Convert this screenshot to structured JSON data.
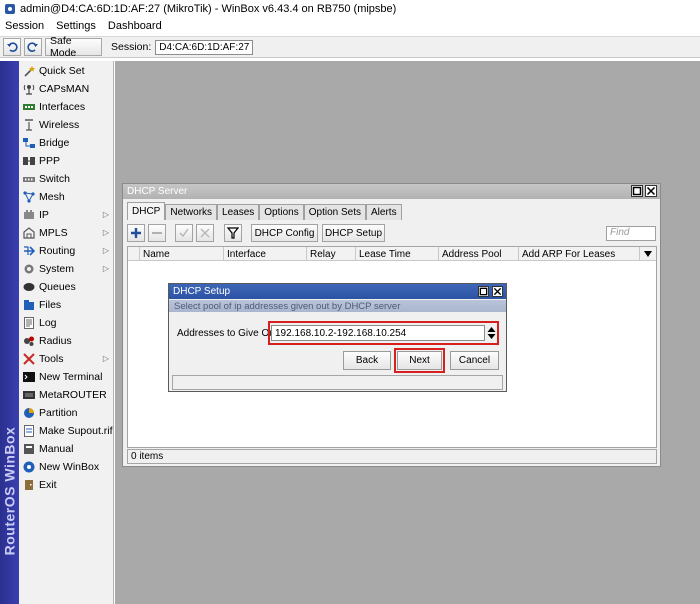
{
  "window": {
    "title": "admin@D4:CA:6D:1D:AF:27 (MikroTik) - WinBox v6.43.4 on RB750 (mipsbe)"
  },
  "menu": [
    "Session",
    "Settings",
    "Dashboard"
  ],
  "toolbar": {
    "safe_mode_label": "Safe Mode",
    "session_label": "Session:",
    "session_value": "D4:CA:6D:1D:AF:27"
  },
  "brand_label": "RouterOS WinBox",
  "sidebar": {
    "items": [
      {
        "label": "Quick Set",
        "icon": "wand-icon",
        "submenu": false
      },
      {
        "label": "CAPsMAN",
        "icon": "antenna-icon",
        "submenu": false
      },
      {
        "label": "Interfaces",
        "icon": "interfaces-icon",
        "submenu": false
      },
      {
        "label": "Wireless",
        "icon": "wireless-icon",
        "submenu": false
      },
      {
        "label": "Bridge",
        "icon": "bridge-icon",
        "submenu": false
      },
      {
        "label": "PPP",
        "icon": "ppp-icon",
        "submenu": false
      },
      {
        "label": "Switch",
        "icon": "switch-icon",
        "submenu": false
      },
      {
        "label": "Mesh",
        "icon": "mesh-icon",
        "submenu": false
      },
      {
        "label": "IP",
        "icon": "ip-icon",
        "submenu": true
      },
      {
        "label": "MPLS",
        "icon": "mpls-icon",
        "submenu": true
      },
      {
        "label": "Routing",
        "icon": "routing-icon",
        "submenu": true
      },
      {
        "label": "System",
        "icon": "system-gear-icon",
        "submenu": true
      },
      {
        "label": "Queues",
        "icon": "queues-icon",
        "submenu": false
      },
      {
        "label": "Files",
        "icon": "files-icon",
        "submenu": false
      },
      {
        "label": "Log",
        "icon": "log-icon",
        "submenu": false
      },
      {
        "label": "Radius",
        "icon": "radius-icon",
        "submenu": false
      },
      {
        "label": "Tools",
        "icon": "tools-icon",
        "submenu": true
      },
      {
        "label": "New Terminal",
        "icon": "terminal-icon",
        "submenu": false
      },
      {
        "label": "MetaROUTER",
        "icon": "metarouter-icon",
        "submenu": false
      },
      {
        "label": "Partition",
        "icon": "partition-icon",
        "submenu": false
      },
      {
        "label": "Make Supout.rif",
        "icon": "supout-icon",
        "submenu": false
      },
      {
        "label": "Manual",
        "icon": "manual-icon",
        "submenu": false
      },
      {
        "label": "New WinBox",
        "icon": "winbox-icon",
        "submenu": false
      },
      {
        "label": "Exit",
        "icon": "exit-icon",
        "submenu": false
      }
    ]
  },
  "dhcp_server": {
    "title": "DHCP Server",
    "tabs": [
      "DHCP",
      "Networks",
      "Leases",
      "Options",
      "Option Sets",
      "Alerts"
    ],
    "dhcp_config_label": "DHCP Config",
    "dhcp_setup_label": "DHCP Setup",
    "find_placeholder": "Find",
    "columns": [
      "Name",
      "Interface",
      "Relay",
      "Lease Time",
      "Address Pool",
      "Add ARP For Leases"
    ],
    "status": "0 items"
  },
  "dhcp_setup": {
    "title": "DHCP Setup",
    "subtitle": "Select pool of ip addresses given out by DHCP server",
    "field_label": "Addresses to Give Out:",
    "field_value": "192.168.10.2-192.168.10.254",
    "back_label": "Back",
    "next_label": "Next",
    "cancel_label": "Cancel"
  },
  "colors": {
    "brand_bar": "#2f34a0",
    "dialog_title": "#2c53a3",
    "highlight": "#d62020",
    "desktop": "#a9a9a9"
  }
}
